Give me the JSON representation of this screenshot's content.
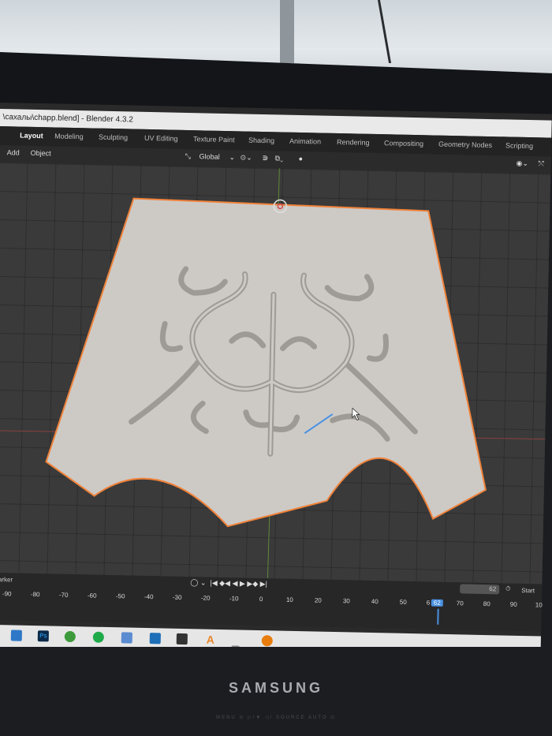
{
  "window": {
    "title": "\\сахалы\\chapp.blend] - Blender 4.3.2"
  },
  "workspace_tabs": [
    {
      "label": "Layout",
      "active": true
    },
    {
      "label": "Modeling"
    },
    {
      "label": "Sculpting"
    },
    {
      "label": "UV Editing"
    },
    {
      "label": "Texture Paint"
    },
    {
      "label": "Shading"
    },
    {
      "label": "Animation"
    },
    {
      "label": "Rendering"
    },
    {
      "label": "Compositing"
    },
    {
      "label": "Geometry Nodes"
    },
    {
      "label": "Scripting"
    }
  ],
  "toolbar": {
    "menu_add": "Add",
    "menu_object": "Object",
    "transform_orientation": "Global"
  },
  "timeline": {
    "marker_label": "Marker",
    "current_frame": "62",
    "start_label": "Start",
    "frame_numbers": [
      "-90",
      "-80",
      "-70",
      "-60",
      "-50",
      "-40",
      "-30",
      "-20",
      "-10",
      "0",
      "10",
      "20",
      "30",
      "40",
      "50",
      "6",
      "62",
      "70",
      "80",
      "90",
      "10"
    ]
  },
  "taskbar": {
    "apps": [
      "file-explorer-icon",
      "photoshop-icon",
      "app-green-icon",
      "app-green2-icon",
      "calculator-icon",
      "security-icon",
      "affinity-icon",
      "font-icon",
      "blender-icon"
    ],
    "ps_label": "Ps",
    "font_label": "A"
  },
  "monitor": {
    "brand": "SAMSUNG",
    "controls_text": "MENU ⊙ ▷/▼ ◁/ SOURCE AUTO ⏻"
  },
  "colors": {
    "accent_blue": "#4a90e2",
    "selection_orange": "#f0823a",
    "viewport_bg": "#3a3a3a",
    "mesh": "#cdcac6"
  }
}
